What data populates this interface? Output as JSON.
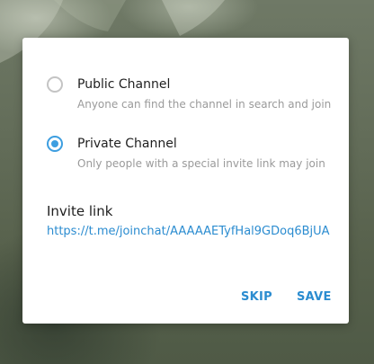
{
  "dialog": {
    "options": [
      {
        "title": "Public Channel",
        "description": "Anyone can find the channel in search and join",
        "selected": false
      },
      {
        "title": "Private Channel",
        "description": "Only people with a special invite link may join",
        "selected": true
      }
    ],
    "invite_label": "Invite link",
    "invite_url": "https://t.me/joinchat/AAAAAETyfHal9GDoq6BjUA",
    "buttons": {
      "skip": "SKIP",
      "save": "SAVE"
    }
  },
  "colors": {
    "accent": "#2b8cd0",
    "radio_checked": "#3d9ee0"
  }
}
